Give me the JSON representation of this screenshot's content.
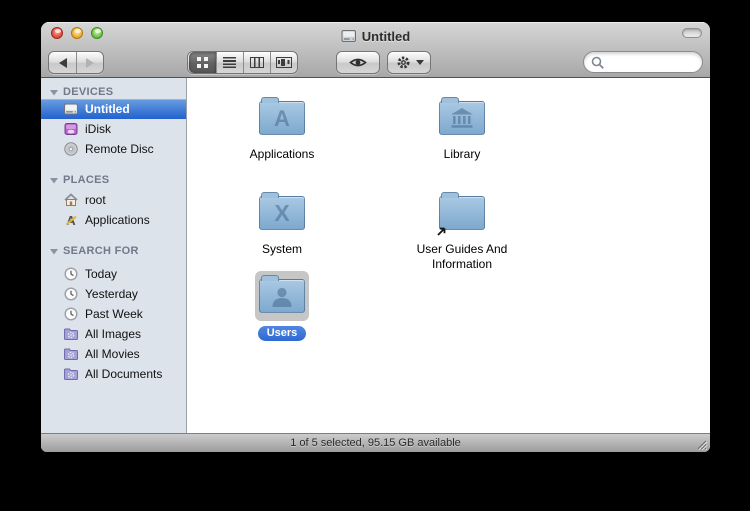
{
  "window": {
    "title": "Untitled"
  },
  "toolbar": {
    "view_modes": [
      "icon-view",
      "list-view",
      "column-view",
      "coverflow-view"
    ],
    "selected_view": "icon-view",
    "buttons": [
      "back",
      "forward",
      "quick-look",
      "action"
    ],
    "search_value": ""
  },
  "sidebar": {
    "sections": [
      {
        "label": "DEVICES",
        "items": [
          {
            "label": "Untitled",
            "icon": "internal-drive",
            "selected": true
          },
          {
            "label": "iDisk",
            "icon": "idisk"
          },
          {
            "label": "Remote Disc",
            "icon": "optical-disc"
          }
        ]
      },
      {
        "label": "PLACES",
        "items": [
          {
            "label": "root",
            "icon": "home"
          },
          {
            "label": "Applications",
            "icon": "applications"
          }
        ]
      },
      {
        "label": "SEARCH FOR",
        "items": [
          {
            "label": "Today",
            "icon": "clock"
          },
          {
            "label": "Yesterday",
            "icon": "clock"
          },
          {
            "label": "Past Week",
            "icon": "clock"
          },
          {
            "label": "All Images",
            "icon": "smart-folder"
          },
          {
            "label": "All Movies",
            "icon": "smart-folder"
          },
          {
            "label": "All Documents",
            "icon": "smart-folder"
          }
        ]
      }
    ]
  },
  "content": {
    "items": [
      {
        "label": "Applications",
        "emblem": "applications-a"
      },
      {
        "label": "Library",
        "emblem": "library-bank"
      },
      {
        "label": "System",
        "emblem": "system-x"
      },
      {
        "label": "User Guides And Information",
        "emblem": "alias-arrow"
      },
      {
        "label": "Users",
        "emblem": "person",
        "selected": true
      }
    ]
  },
  "statusbar": {
    "text": "1 of 5 selected, 95.15 GB available"
  },
  "colors": {
    "selection_blue": "#2e68d2",
    "sidebar_selected_gradient_top": "#6b9fe0",
    "sidebar_bg": "#dce3ea",
    "folder_blue_top": "#a9c9e3",
    "folder_blue_bottom": "#7ea9ce",
    "icon_selection_gray": "#c6c6c6"
  }
}
